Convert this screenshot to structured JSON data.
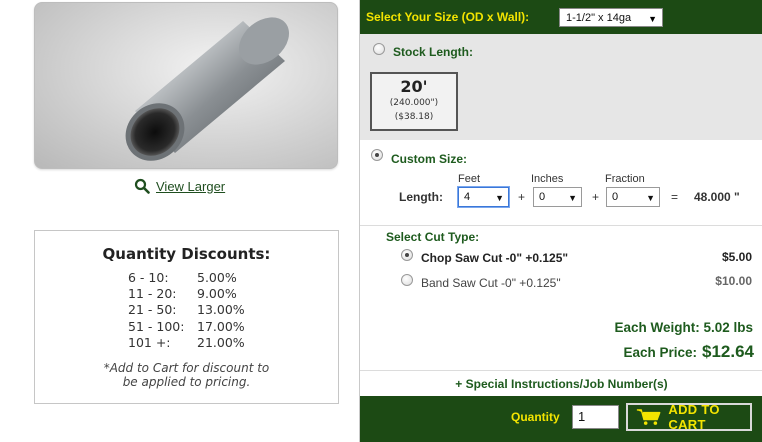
{
  "product": {
    "view_larger": "View Larger"
  },
  "discounts": {
    "title": "Quantity Discounts:",
    "rows": [
      {
        "range": "6 - 10:",
        "pct": "5.00%"
      },
      {
        "range": "11 - 20:",
        "pct": "9.00%"
      },
      {
        "range": "21 - 50:",
        "pct": "13.00%"
      },
      {
        "range": "51 - 100:",
        "pct": "17.00%"
      },
      {
        "range": "101 +:",
        "pct": "21.00%"
      }
    ],
    "note_line1": "*Add to Cart for discount to",
    "note_line2": "be applied to pricing."
  },
  "size": {
    "label": "Select Your Size (OD x Wall):",
    "selected": "1-1/2\" x 14ga"
  },
  "stock_length": {
    "label": "Stock Length:",
    "selected": false,
    "length": "20'",
    "inches": "(240.000\")",
    "price": "($38.18)"
  },
  "custom_size": {
    "label": "Custom Size:",
    "selected": true,
    "length_label": "Length:",
    "feet_label": "Feet",
    "inches_label": "Inches",
    "fraction_label": "Fraction",
    "feet_value": "4",
    "inches_value": "0",
    "fraction_value": "0",
    "plus": "+",
    "equals": "=",
    "total": "48.000 \""
  },
  "cut_type": {
    "label": "Select Cut Type:",
    "options": [
      {
        "label": "Chop Saw Cut -0\" +0.125\"",
        "price": "$5.00",
        "selected": true
      },
      {
        "label": "Band Saw Cut -0\" +0.125\"",
        "price": "$10.00",
        "selected": false
      }
    ]
  },
  "summary": {
    "weight_label": "Each Weight: 5.02 lbs",
    "price_label": "Each Price:",
    "price_value": "$12.64"
  },
  "special_instructions": "+ Special Instructions/Job Number(s)",
  "cart": {
    "quantity_label": "Quantity",
    "quantity_value": "1",
    "add_to_cart": "ADD TO CART"
  },
  "colors": {
    "brand_green": "#1c4a14",
    "accent_yellow": "#f3e400",
    "label_green": "#1e5b1e"
  }
}
